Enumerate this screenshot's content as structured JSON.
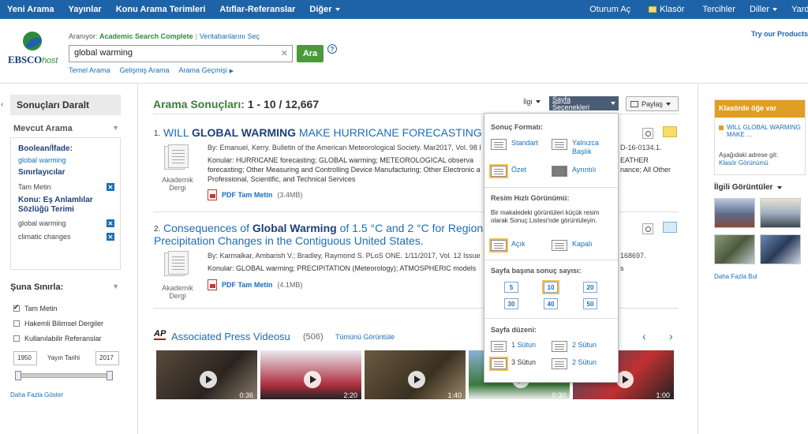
{
  "topnav": {
    "left": [
      "Yeni Arama",
      "Yayınlar",
      "Konu Arama Terimleri",
      "Atıflar-Referanslar",
      "Diğer"
    ],
    "oturum": "Oturum Aç",
    "klasor": "Klasör",
    "tercihler": "Tercihler",
    "diller": "Diller",
    "yardim": "Yardım"
  },
  "header": {
    "logo_main": "EBSCO",
    "logo_sub": "host",
    "searching_label": "Aranıyor:",
    "searching_db": "Academic Search Complete",
    "choose_db": "Veritabanlarını Seç",
    "query": "global warming",
    "search_button": "Ara",
    "help": "?",
    "links": [
      "Temel Arama",
      "Gelişmiş Arama",
      "Arama Geçmişi"
    ],
    "try": "Try our Products"
  },
  "left": {
    "title": "Sonuçları Daralt",
    "mevcut": "Mevcut Arama",
    "boolean_h": "Boolean/İfade:",
    "boolean_v": "global warming",
    "siniri_h": "Sınırlayıcılar",
    "siniri_v": "Tam Metin",
    "konu_h": "Konu: Eş Anlamlılar Sözlüğü Terimi",
    "konu_v1": "global warming",
    "konu_v2": "climatic changes",
    "suna": "Şuna Sınırla:",
    "opts": [
      "Tam Metin",
      "Hakemli Bilimsel Dergiler",
      "Kullanılabilir Referanslar"
    ],
    "year_from": "1950",
    "year_label": "Yayın Tarihi",
    "year_to": "2017",
    "more": "Daha Fazla Göster"
  },
  "main": {
    "title": "Arama Sonuçları:",
    "range": "1 - 10 / 12,667",
    "ilgi": "İlgi",
    "sayfa": "Sayfa Seçenekleri",
    "paylas": "Paylaş",
    "r1": {
      "num": "1.",
      "t1": "WILL",
      "t2": "GLOBAL WARMING",
      "t3": "MAKE HURRICANE FORECASTING M",
      "meta": "By: Emanuel, Kerry. Bulletin of the American Meteorological Society. Mar2017, Vol. 98 I",
      "meta_tail": "D-16-0134.1.",
      "subj1": "Konular: HURRICANE forecasting; GLOBAL warming; METEOROLOGICAL observa",
      "subj1_tail": "EATHER",
      "subj2": "forecasting; Other Measuring and Controlling Device Manufacturing; Other Electronic a",
      "subj2_tail": "nance; All Other",
      "subj3": "Professional, Scientific, and Technical Services",
      "type": "Akademik Dergi",
      "pdf": "PDF Tam Metin",
      "size": "(3.4MB)"
    },
    "r2": {
      "num": "2.",
      "t1": "Consequences of",
      "t2": "Global Warming",
      "t3": "of 1.5 °C and 2 °C for Regional",
      "t4": "Precipitation Changes in the Contiguous United States.",
      "meta": "By: Karmalkar, Ambarish V.; Bradley, Raymond S. PLoS ONE. 1/11/2017, Vol. 12 Issue",
      "meta_tail": "168697.",
      "subj": "Konular: GLOBAL warming; PRECIPITATION (Meteorology); ATMOSPHERIC models",
      "subj_tail": "s",
      "type": "Akademik Dergi",
      "pdf": "PDF Tam Metin",
      "size": "(4.1MB)"
    },
    "videos": {
      "ap": "AP",
      "title": "Associated Press Videosu",
      "count": "(506)",
      "all": "Tümünü Görüntüle",
      "prev": "‹",
      "next": "›",
      "durations": [
        "0:36",
        "2:20",
        "1:40",
        "0:30",
        "1:00"
      ]
    }
  },
  "panel": {
    "fmt_title": "Sonuç Formatı:",
    "fmt": [
      "Standart",
      "Yalnızca Başlık",
      "Özet",
      "Ayrıntılı"
    ],
    "img_title": "Resim Hızlı Görünümü:",
    "img_desc": "Bir makaledeki görüntüleri küçük resim olarak Sonuç Listesi'nde görüntüleyin.",
    "img": [
      "Açık",
      "Kapalı"
    ],
    "per_title": "Sayfa başına sonuç sayısı:",
    "per": [
      "5",
      "10",
      "20",
      "30",
      "40",
      "50"
    ],
    "layout_title": "Sayfa düzeni:",
    "layout": [
      "1 Sütun",
      "2 Sütun",
      "3 Sütun",
      "2 Sütun"
    ]
  },
  "right": {
    "klasor_h": "Klasörde öğe var",
    "klasor_item": "WILL GLOBAL WARMING MAKE ...",
    "klasor_go": "Aşağıdaki adrese git:",
    "klasor_view": "Klasör Görünümü",
    "ilgili": "İlgili Görüntüler",
    "more": "Daha Fazla Bul"
  }
}
